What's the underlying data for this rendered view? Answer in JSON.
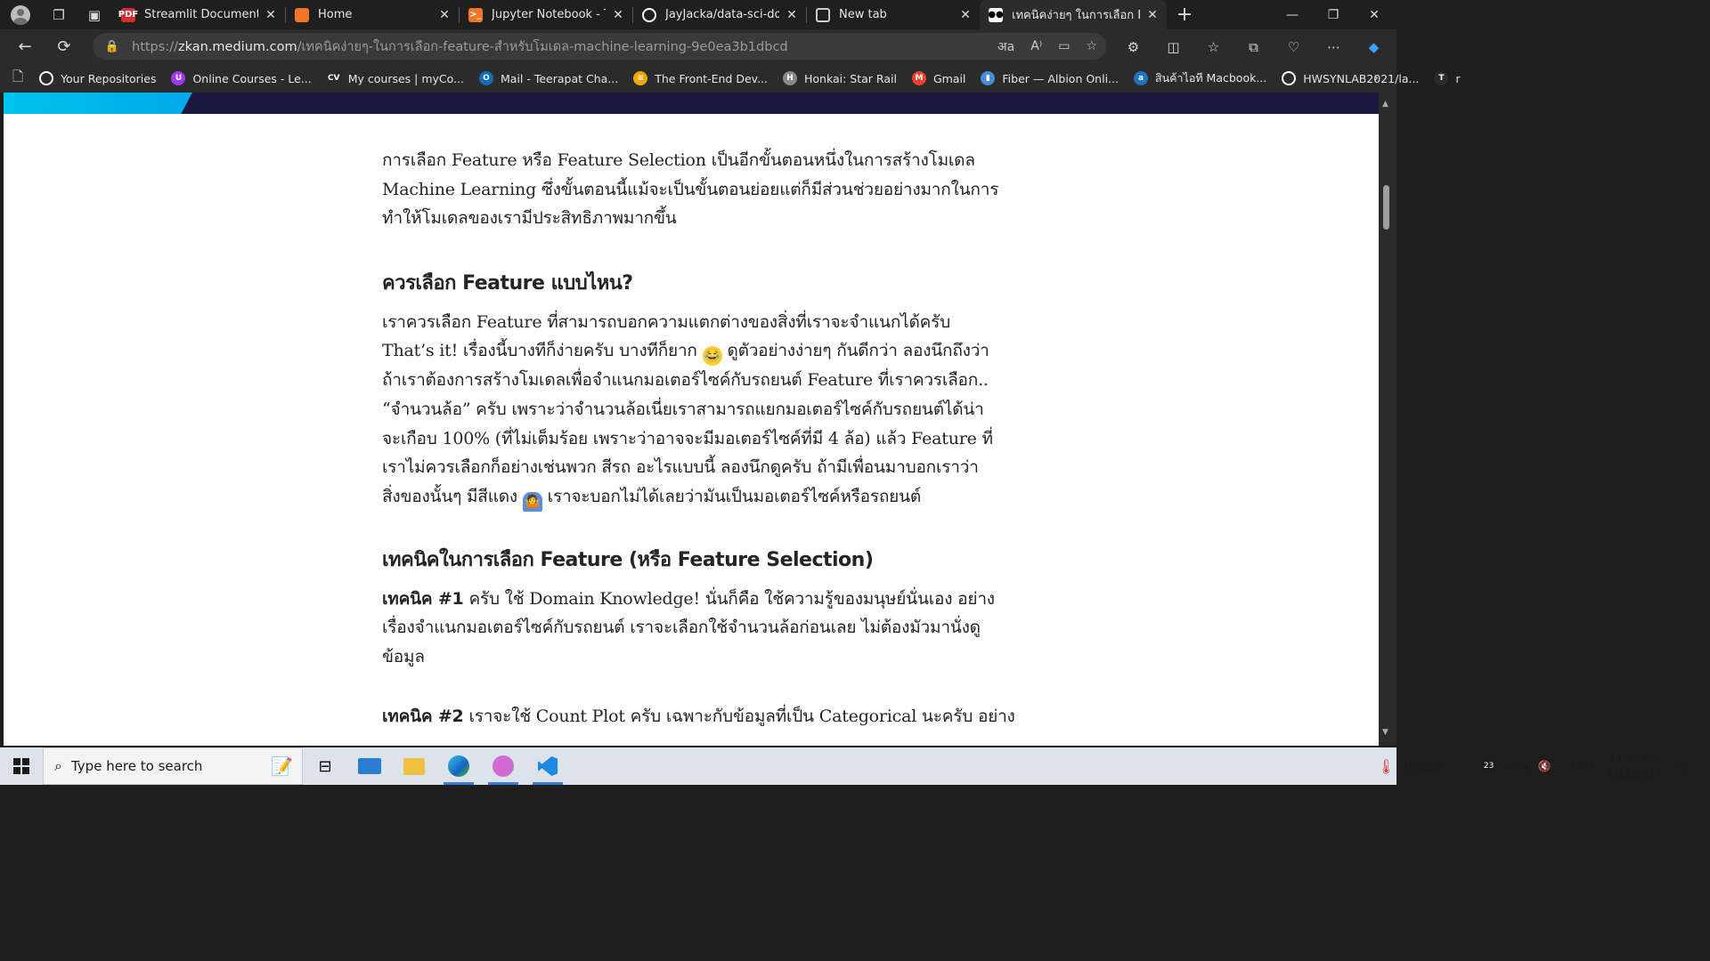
{
  "tabs": [
    {
      "title": "Streamlit Documentation",
      "icon": "pdf-icon",
      "color": "#d32f2f",
      "glyph": "PDF"
    },
    {
      "title": "Home",
      "icon": "jupyter-icon",
      "color": "#f37626",
      "glyph": ""
    },
    {
      "title": "Jupyter Notebook - Term",
      "icon": "terminal-icon",
      "color": "#f37626",
      "glyph": ">_"
    },
    {
      "title": "JayJacka/data-sci-docs",
      "icon": "github-icon",
      "color": "#ffffff",
      "glyph": ""
    },
    {
      "title": "New tab",
      "icon": "newtab-icon",
      "color": "#cccccc",
      "glyph": ""
    },
    {
      "title": "เทคนิคง่ายๆ ในการเลือก Feat",
      "icon": "medium-icon",
      "color": "#ffffff",
      "glyph": "●●",
      "active": true
    }
  ],
  "address": {
    "scheme": "https://",
    "host": "zkan.medium.com",
    "path": "/เทคนิคง่ายๆ-ในการเลือก-feature-สำหรับโมเดล-machine-learning-9e0ea3b1dbcd"
  },
  "bookmarks": [
    {
      "label": "Your Repositories",
      "icon": "github-icon",
      "color": "#ffffff",
      "glyph": ""
    },
    {
      "label": "Online Courses - Le...",
      "icon": "udemy-icon",
      "color": "#a435f0",
      "glyph": "U"
    },
    {
      "label": "My courses | myCo...",
      "icon": "cv-icon",
      "color": "#2b2b2b",
      "glyph": "CV"
    },
    {
      "label": "Mail - Teerapat Cha...",
      "icon": "outlook-icon",
      "color": "#0f6cbd",
      "glyph": "O"
    },
    {
      "label": "The Front-End Dev...",
      "icon": "frontend-icon",
      "color": "#f0a500",
      "glyph": "≡"
    },
    {
      "label": "Honkai: Star Rail",
      "icon": "honkai-icon",
      "color": "#888888",
      "glyph": "H"
    },
    {
      "label": "Gmail",
      "icon": "gmail-icon",
      "color": "#ea4335",
      "glyph": "M"
    },
    {
      "label": "Fiber — Albion Onli...",
      "icon": "fiber-icon",
      "color": "#4a8bd6",
      "glyph": "▮"
    },
    {
      "label": "สินค้าไอที Macbook...",
      "icon": "advice-icon",
      "color": "#1e73be",
      "glyph": "a"
    },
    {
      "label": "HWSYNLAB2021/la...",
      "icon": "github-icon",
      "color": "#ffffff",
      "glyph": ""
    },
    {
      "label": "r",
      "icon": "translate-icon",
      "color": "#2b2b2b",
      "glyph": "T"
    }
  ],
  "article": {
    "intro": "การเลือก Feature หรือ Feature Selection เป็นอีกขั้นตอนหนึ่งในการสร้างโมเดล Machine Learning ซึ่งขั้นตอนนี้แม้จะเป็นขั้นตอนย่อยแต่ก็มีส่วนช่วยอย่างมากในการทำให้โมเดลของเรามีประสิทธิภาพมากขึ้น",
    "h1": "ควรเลือก Feature แบบไหน?",
    "p1_lines": [
      "เราควรเลือก Feature ที่สามารถบอกความแตกต่างของสิ่งที่เราจะจำแนกได้ครับ",
      "That’s it! เรื่องนี้บางทีก็ง่ายครับ บางทีก็ยาก",
      "ถ้าเราต้องการสร้างโมเดลเพื่อจำแนกมอเตอร์ไซค์กับรถยนต์ Feature ที่เราควรเลือก..",
      "“จำนวนล้อ” ครับ เพราะว่าจำนวนล้อเนี่ยเราสามารถแยกมอเตอร์ไซค์กับรถยนต์ได้น่า",
      "จะเกือบ 100% (ที่ไม่เต็มร้อย เพราะว่าอาจจะมีมอเตอร์ไซค์ที่มี 4 ล้อ) แล้ว Feature ที่",
      "เราไม่ควรเลือกก็อย่างเช่นพวก สีรถ อะไรแบบนี้ ลองนึกดูครับ ถ้ามีเพื่อนมาบอกเราว่า",
      "สิ่งของนั้นๆ มีสีแดง"
    ],
    "p1_after_emoji1": "ดูตัวอย่างง่ายๆ กันดีกว่า ลองนึกถึงว่า",
    "p1_after_emoji2": "เราจะบอกไม่ได้เลยว่ามันเป็นมอเตอร์ไซค์หรือรถยนต์",
    "h2": "เทคนิคในการเลือก Feature (หรือ Feature Selection)",
    "t1_label": "เทคนิค #1",
    "t1_lines": [
      "ครับ ใช้ Domain Knowledge! นั่นก็คือ ใช้ความรู้ของมนุษย์นั่นเอง อย่าง",
      "เรื่องจำแนกมอเตอร์ไซค์กับรถยนต์ เราจะเลือกใช้จำนวนล้อก่อนเลย ไม่ต้องมัวมานั่งดู",
      "ข้อมูล"
    ],
    "t2_label": "เทคนิค #2",
    "t2_text": "เราจะใช้ Count Plot ครับ เฉพาะกับข้อมูลที่เป็น Categorical นะครับ อย่าง"
  },
  "taskbar": {
    "search_placeholder": "Type here to search",
    "weather": "ใกล้สถิติ",
    "lang": "ENG",
    "time": "11:02 AM",
    "date": "4/23/2024",
    "notif_count": "23"
  }
}
